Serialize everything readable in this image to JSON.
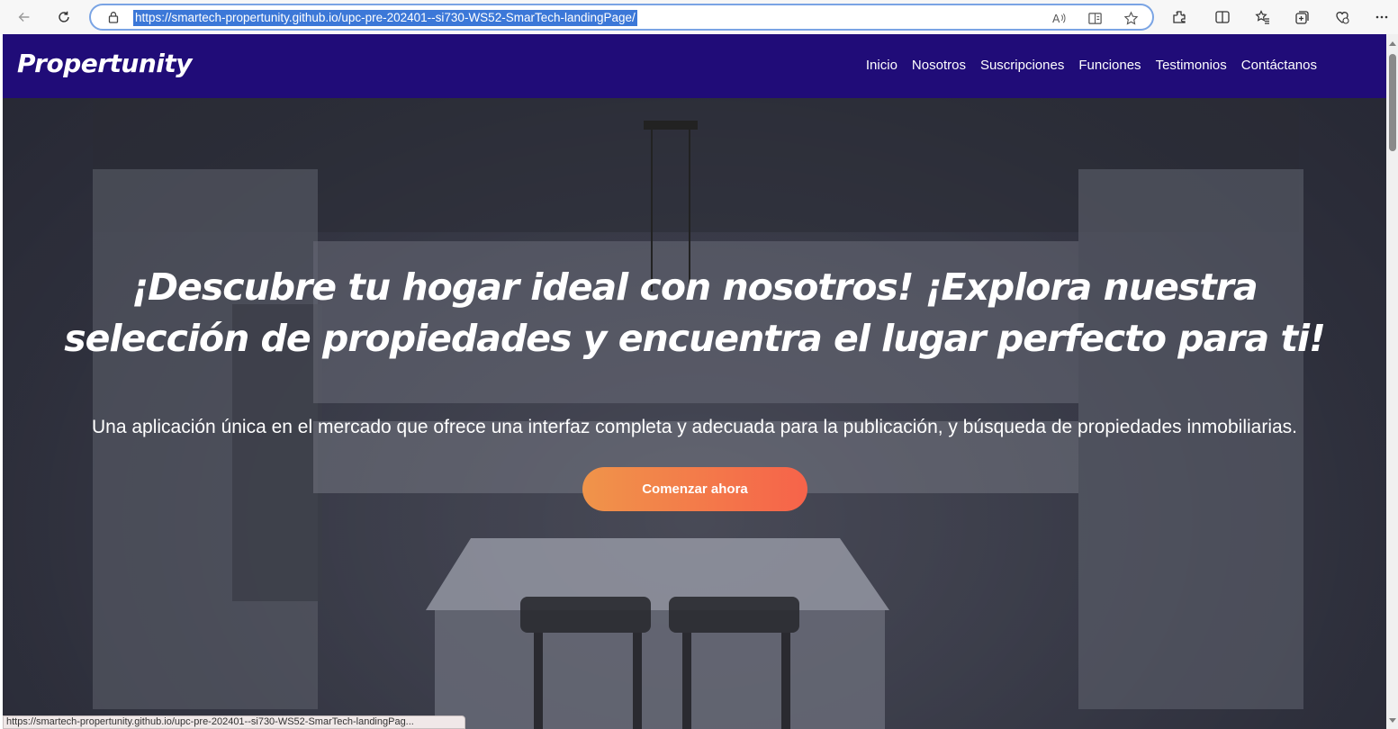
{
  "browser": {
    "url": "https://smartech-propertunity.github.io/upc-pre-202401--si730-WS52-SmarTech-landingPage/",
    "status_url": "https://smartech-propertunity.github.io/upc-pre-202401--si730-WS52-SmarTech-landingPag..."
  },
  "site": {
    "brand": "Propertunity",
    "nav": [
      "Inicio",
      "Nosotros",
      "Suscripciones",
      "Funciones",
      "Testimonios",
      "Contáctanos"
    ]
  },
  "hero": {
    "title": "¡Descubre tu hogar ideal con nosotros! ¡Explora nuestra selección de propiedades y encuentra el lugar perfecto para ti!",
    "subtitle": "Una aplicación única en el mercado que ofrece una interfaz completa y adecuada para la publicación, y búsqueda de propiedades inmobiliarias.",
    "cta": "Comenzar ahora"
  },
  "colors": {
    "navbar": "#200c78",
    "cta_start": "#f0944a",
    "cta_end": "#f6634a",
    "address_border": "#7aa4e4"
  },
  "icons": [
    "back-icon",
    "refresh-icon",
    "lock-icon",
    "read-aloud-icon",
    "immersive-reader-icon",
    "favorite-star-icon",
    "extensions-icon",
    "split-screen-icon",
    "favorites-icon",
    "collections-icon",
    "copilot-icon",
    "more-icon"
  ]
}
